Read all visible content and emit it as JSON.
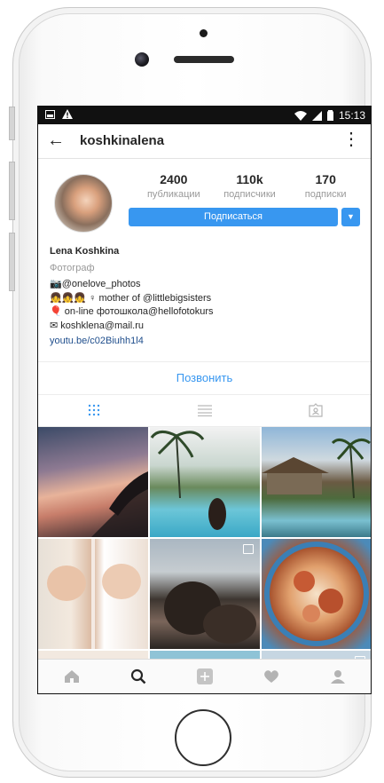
{
  "status_bar": {
    "time": "15:13"
  },
  "header": {
    "username": "koshkinalena"
  },
  "profile": {
    "stats": [
      {
        "value": "2400",
        "label": "публикации"
      },
      {
        "value": "110k",
        "label": "подписчики"
      },
      {
        "value": "170",
        "label": "подписки"
      }
    ],
    "follow_button": "Подписаться"
  },
  "bio": {
    "name": "Lena Koshkina",
    "category": "Фотограф",
    "lines": [
      "@onelove_photos",
      "♀ mother of @littlebigsisters",
      "on-line фотошкола@hellofotokurs",
      "koshklena@mail.ru"
    ],
    "link": "youtu.be/c02Biuhh1l4"
  },
  "call_button": "Позвонить",
  "colors": {
    "accent": "#3897f0",
    "tab_active": "#3897f0",
    "tab_inactive": "#b5b5b5"
  },
  "icons": {
    "tabs": [
      "grid-icon",
      "list-icon",
      "tagged-icon"
    ],
    "bottom_nav": [
      "home-icon",
      "search-icon",
      "add-post-icon",
      "heart-icon",
      "profile-icon"
    ]
  }
}
